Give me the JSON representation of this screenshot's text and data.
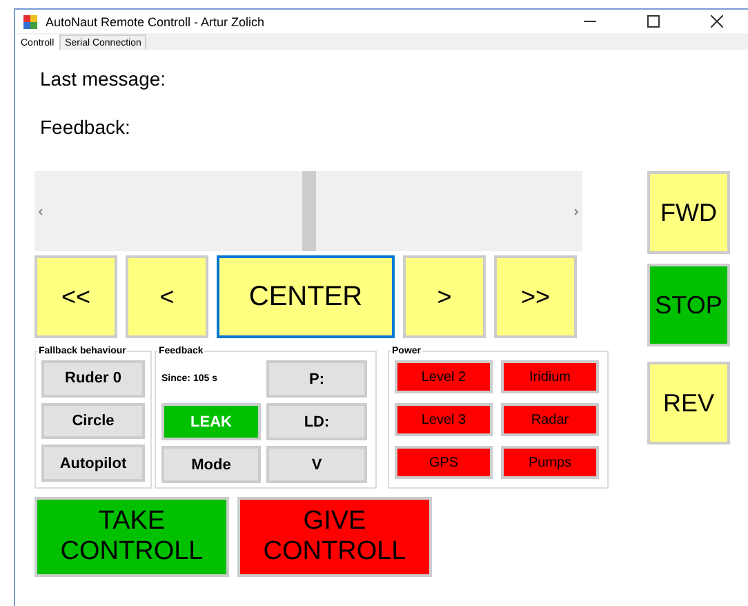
{
  "window": {
    "title": "AutoNaut Remote Controll - Artur Zolich"
  },
  "tabs": [
    {
      "label": "Controll",
      "selected": true
    },
    {
      "label": "Serial Connection",
      "selected": false
    }
  ],
  "labels": {
    "last_message": "Last message:",
    "feedback": "Feedback:"
  },
  "rudder_slider": {
    "level": 0.5
  },
  "steer_buttons": [
    {
      "label": "<<",
      "focused": false
    },
    {
      "label": "<",
      "focused": false
    },
    {
      "label": "CENTER",
      "focused": true
    },
    {
      "label": ">",
      "focused": false
    },
    {
      "label": ">>",
      "focused": false
    }
  ],
  "drive_buttons": [
    {
      "label": "FWD",
      "color": "#ffff80"
    },
    {
      "label": "STOP",
      "color": "#00c000"
    },
    {
      "label": "REV",
      "color": "#ffff80"
    }
  ],
  "fallback": {
    "title": "Fallback behaviour",
    "buttons": [
      {
        "label": "Ruder 0",
        "color": "#e1e1e1"
      },
      {
        "label": "Circle",
        "color": "#e1e1e1"
      },
      {
        "label": "Autopilot",
        "color": "#e1e1e1"
      }
    ]
  },
  "feedback": {
    "title": "Feedback",
    "since": "Since: 105 s",
    "buttons": [
      {
        "label": "P:",
        "color": "#e1e1e1"
      },
      {
        "label": "LEAK",
        "color": "#00c000",
        "kind": "indicator"
      },
      {
        "label": "LD:",
        "color": "#e1e1e1"
      },
      {
        "label": "Mode",
        "color": "#e1e1e1"
      },
      {
        "label": "V",
        "color": "#e1e1e1"
      }
    ]
  },
  "power": {
    "title": "Power",
    "buttons": [
      {
        "label": "Level 2",
        "color": "#ff0000"
      },
      {
        "label": "Iridium",
        "color": "#ff0000"
      },
      {
        "label": "Level 3",
        "color": "#ff0000"
      },
      {
        "label": "Radar",
        "color": "#ff0000"
      },
      {
        "label": "GPS",
        "color": "#ff0000"
      },
      {
        "label": "Pumps",
        "color": "#ff0000"
      }
    ]
  },
  "control_buttons": [
    {
      "label": "TAKE CONTROLL",
      "color": "#00c000"
    },
    {
      "label": "GIVE CONTROLL",
      "color": "#ff0000"
    }
  ]
}
